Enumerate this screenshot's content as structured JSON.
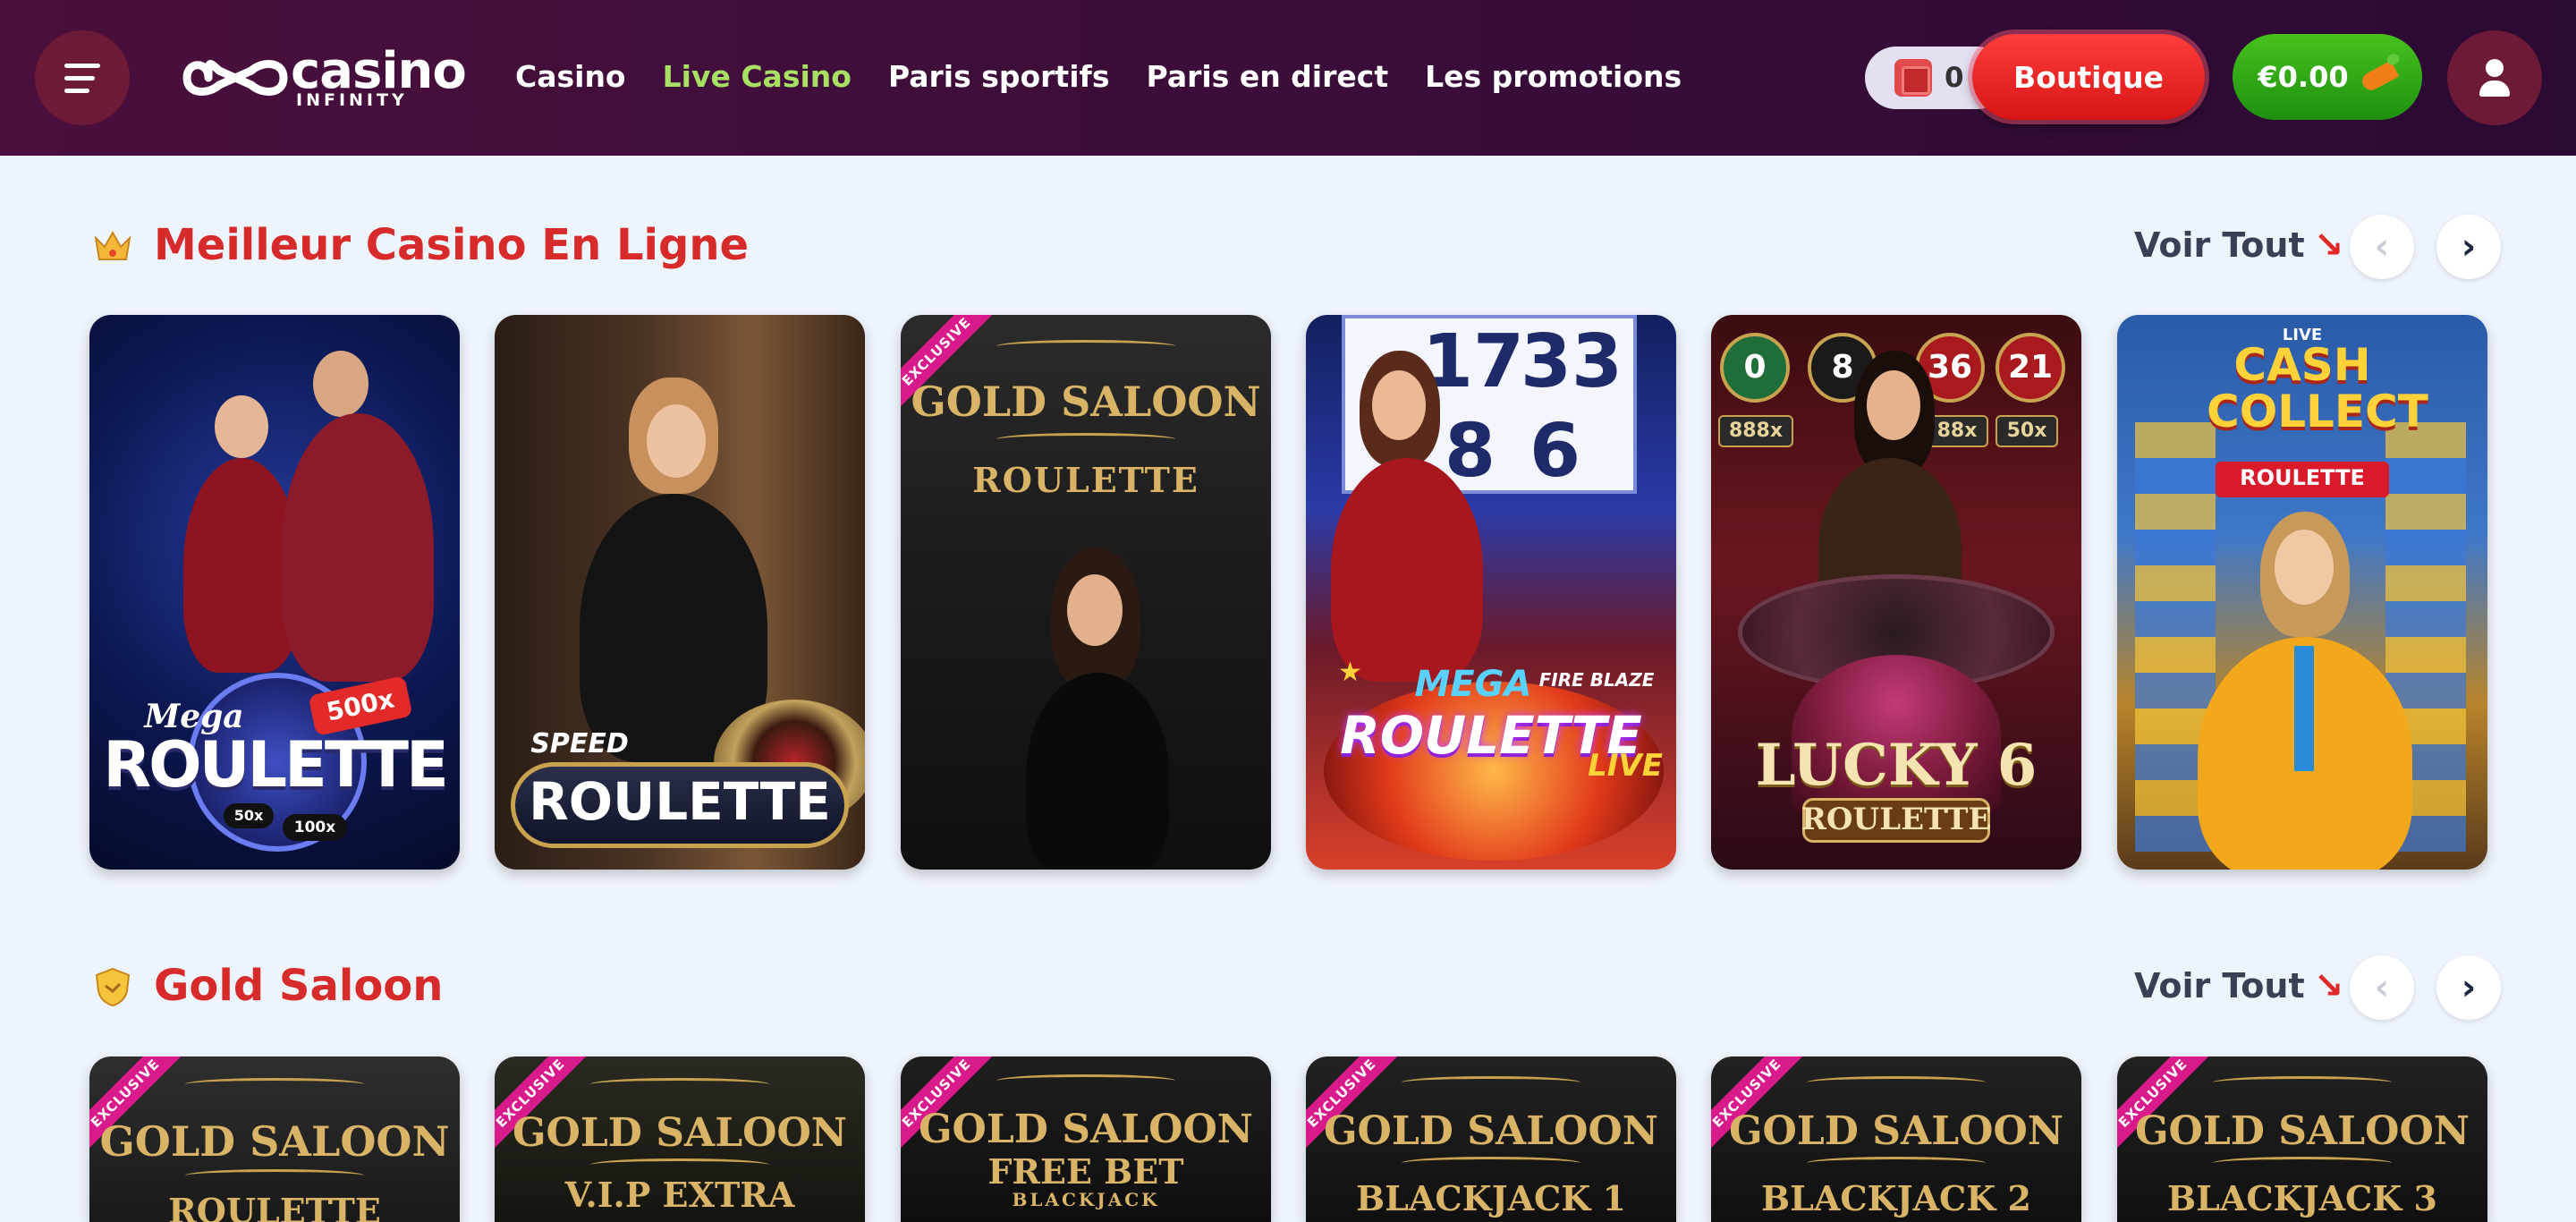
{
  "header": {
    "logo_main": "casino",
    "logo_sub": "INFINITY",
    "nav": [
      {
        "label": "Casino"
      },
      {
        "label": "Live Casino",
        "active": true
      },
      {
        "label": "Paris sportifs"
      },
      {
        "label": "Paris en direct"
      },
      {
        "label": "Les promotions"
      }
    ],
    "points_count": "0",
    "boutique_label": "Boutique",
    "balance": "€0.00"
  },
  "sections": [
    {
      "title": "Meilleur Casino En Ligne",
      "icon": "crown-icon",
      "view_all": "Voir Tout",
      "cards": [
        {
          "name": "Mega Roulette",
          "logo_small": "Mega",
          "logo_main": "ROULETTE",
          "multiplier": "500x",
          "badge1": "50x",
          "badge2": "100x"
        },
        {
          "name": "Speed Roulette",
          "logo_small": "SPEED",
          "logo_main": "ROULETTE"
        },
        {
          "name": "Gold Saloon Roulette",
          "ribbon": "EXCLUSIVE",
          "title": "GOLD SALOON",
          "subtitle": "ROULETTE"
        },
        {
          "name": "Mega Fire Blaze Roulette Live",
          "numbers": [
            "17",
            "33",
            "8",
            "6"
          ],
          "logo_top": "MEGA",
          "logo_fire": "FIRE BLAZE",
          "logo_main": "ROULETTE",
          "logo_live": "LIVE"
        },
        {
          "name": "Lucky 6 Roulette",
          "balls": [
            "0",
            "8",
            "36",
            "21"
          ],
          "mult1": "888x",
          "mult2": "88x",
          "mult3": "50x",
          "logo_main": "LUCKY 6",
          "logo_sub": "ROULETTE"
        },
        {
          "name": "Cash Collect Roulette",
          "logo_live": "LIVE",
          "logo_main": "CASH COLLECT",
          "logo_sub": "ROULETTE"
        }
      ]
    },
    {
      "title": "Gold Saloon",
      "icon": "shield-badge-icon",
      "view_all": "Voir Tout",
      "cards": [
        {
          "ribbon": "EXCLUSIVE",
          "title": "GOLD SALOON",
          "subtitle": "ROULETTE"
        },
        {
          "ribbon": "EXCLUSIVE",
          "title": "GOLD SALOON",
          "subtitle": "V.I.P EXTRA"
        },
        {
          "ribbon": "EXCLUSIVE",
          "title": "GOLD SALOON",
          "subtitle": "FREE BET",
          "subtitle2": "BLACKJACK"
        },
        {
          "ribbon": "EXCLUSIVE",
          "title": "GOLD SALOON",
          "subtitle": "BLACKJACK 1"
        },
        {
          "ribbon": "EXCLUSIVE",
          "title": "GOLD SALOON",
          "subtitle": "BLACKJACK 2"
        },
        {
          "ribbon": "EXCLUSIVE",
          "title": "GOLD SALOON",
          "subtitle": "BLACKJACK 3"
        }
      ]
    }
  ],
  "colors": {
    "header_bg": "#3b0d3a",
    "accent_red": "#d72a2a",
    "nav_active": "#a8e063",
    "balance_green": "#2aa514",
    "ribbon_pink": "#d81a8a",
    "gold_text": "#d9b467"
  }
}
